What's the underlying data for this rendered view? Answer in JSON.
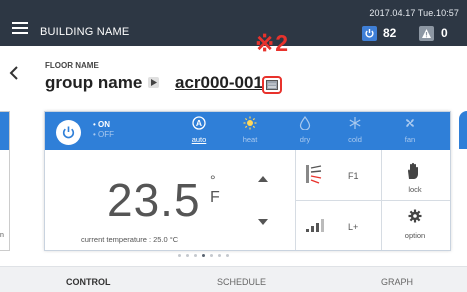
{
  "topbar": {
    "building_name": "BUILDING NAME",
    "datetime": "2017.04.17 Tue.10:57",
    "on_count": "82",
    "warning_count": "0"
  },
  "annotation": "※2",
  "header": {
    "floor_name": "FLOOR NAME",
    "group_name": "group name",
    "unit_name": "acr000-001"
  },
  "side_left_label": "n",
  "power": {
    "on_label": "ON",
    "off_label": "OFF",
    "state": "on"
  },
  "modes": [
    {
      "key": "auto",
      "label": "auto",
      "active": true
    },
    {
      "key": "heat",
      "label": "heat",
      "active": false
    },
    {
      "key": "dry",
      "label": "dry",
      "active": false
    },
    {
      "key": "cold",
      "label": "cold",
      "active": false
    },
    {
      "key": "fan",
      "label": "fan",
      "active": false
    }
  ],
  "temperature": {
    "set_value": "23.5",
    "unit_symbol": "°",
    "unit_letter": "F",
    "current_label": "current temperature : 25.0 °C"
  },
  "controls": {
    "vane_label": "F1",
    "fan_speed_label": "L+",
    "lock_label": "lock",
    "option_label": "option"
  },
  "pager": {
    "count": 7,
    "active_index": 3
  },
  "tabs": {
    "control": "CONTROL",
    "schedule": "SCHEDULE",
    "graph": "GRAPH"
  },
  "colors": {
    "topbar": "#2d3744",
    "mode_bar": "#2f7fd8",
    "annotation": "#e8322c"
  }
}
